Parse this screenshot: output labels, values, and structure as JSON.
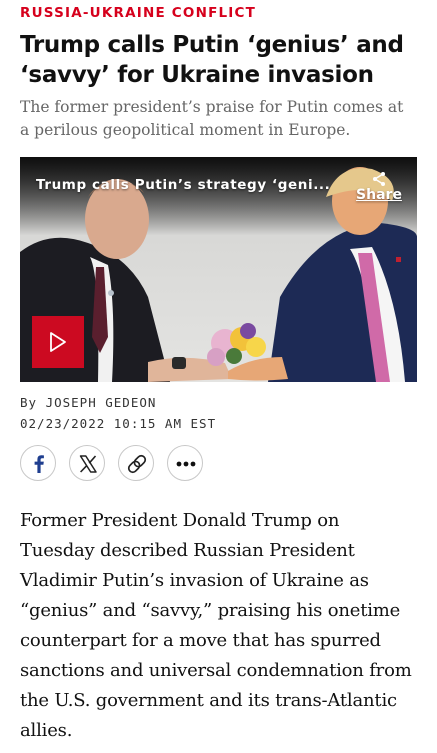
{
  "article": {
    "kicker": "RUSSIA-UKRAINE CONFLICT",
    "headline": "Trump calls Putin ‘genius’ and ‘savvy’ for Ukraine invasion",
    "dek": "The former president’s praise for Putin comes at a perilous geopolitical moment in Europe.",
    "byline": "By JOSEPH GEDEON",
    "date": "02/23/2022 10:15 AM EST",
    "body": "Former President Donald Trump on Tuesday described Russian President Vladimir Putin’s invasion of Ukraine as “genius” and “savvy,” praising his onetime counterpart for a move that has spurred sanctions and universal condemnation from the U.S. government and its trans-Atlantic allies."
  },
  "video": {
    "title": "Trump calls Putin’s strategy ‘geni...",
    "share_label": "Share",
    "play_icon": "play-icon",
    "share_icon": "share-icon"
  },
  "social": {
    "buttons": [
      {
        "icon": "facebook-icon"
      },
      {
        "icon": "x-icon"
      },
      {
        "icon": "link-icon"
      },
      {
        "icon": "more-icon"
      }
    ]
  },
  "colors": {
    "kicker": "#d6001c",
    "play_button": "#cc0a21",
    "dek": "#666666"
  }
}
